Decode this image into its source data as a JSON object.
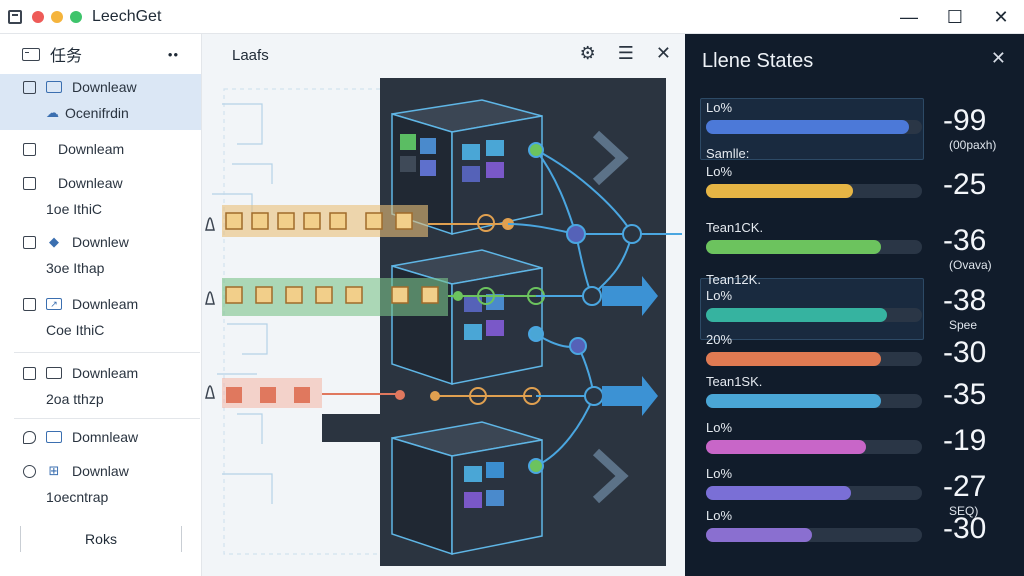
{
  "window": {
    "title": "LeechGet",
    "controls": {
      "minimize": "—",
      "maximize": "☐",
      "close": "✕"
    }
  },
  "sidebar": {
    "header": "任务",
    "more": "••",
    "items": [
      {
        "label": "Downleaw",
        "sub": "Ocenifrdin",
        "icon": "folder-icon",
        "active": true
      },
      {
        "label": "Downleam",
        "sub": "",
        "icon": "none"
      },
      {
        "label": "Downleaw",
        "sub": "1oe IthiC",
        "icon": "none"
      },
      {
        "label": "Downlew",
        "sub": "3oe Ithap",
        "icon": "dropbox-icon"
      },
      {
        "label": "Downleam",
        "sub": "Coe IthiC",
        "icon": "chart-icon"
      },
      {
        "label": "Downleam",
        "sub": "2oa tthzp",
        "icon": "file-icon"
      },
      {
        "label": "Domnleaw",
        "sub": "",
        "icon": "folder-icon"
      },
      {
        "label": "Downlaw",
        "sub": "1oecntrap",
        "icon": "grid-icon"
      }
    ],
    "footer": "Roks"
  },
  "center": {
    "title": "Laafs"
  },
  "stats": {
    "title": "Llene States",
    "close": "✕",
    "rows": [
      {
        "label": "Lo%",
        "value": "-99",
        "note": "(00paxh)",
        "fill": 0.94,
        "color": "#4c79d8",
        "boxed": true,
        "box_label": "Samlle:"
      },
      {
        "label": "Lo%",
        "value": "-25",
        "note": "",
        "fill": 0.68,
        "color": "#e6b545"
      },
      {
        "label": "Tean1CK.",
        "value": "-36",
        "note": "(Ovava)",
        "fill": 0.81,
        "color": "#6cc35e"
      },
      {
        "label": "Lo%",
        "value": "-38",
        "note": "Spee",
        "fill": 0.84,
        "color": "#36b3a0",
        "boxed": true,
        "box_label": "Tean12K."
      },
      {
        "label": "20%",
        "value": "-30",
        "note": "",
        "fill": 0.81,
        "color": "#e07a52"
      },
      {
        "label": "Tean1SK.",
        "value": "-35",
        "note": "",
        "fill": 0.81,
        "color": "#4aa6d6"
      },
      {
        "label": "Lo%",
        "value": "-19",
        "note": "",
        "fill": 0.74,
        "color": "#c866c8"
      },
      {
        "label": "Lo%",
        "value": "-27",
        "note": "SEQ)",
        "fill": 0.67,
        "color": "#7a6fd6"
      },
      {
        "label": "Lo%",
        "value": "-30",
        "note": "",
        "fill": 0.49,
        "color": "#8a6fd0"
      }
    ]
  },
  "colors": {
    "accent": "#3b6fb0",
    "panel_dark": "#111c2b",
    "active_row": "#dbe7f5"
  }
}
